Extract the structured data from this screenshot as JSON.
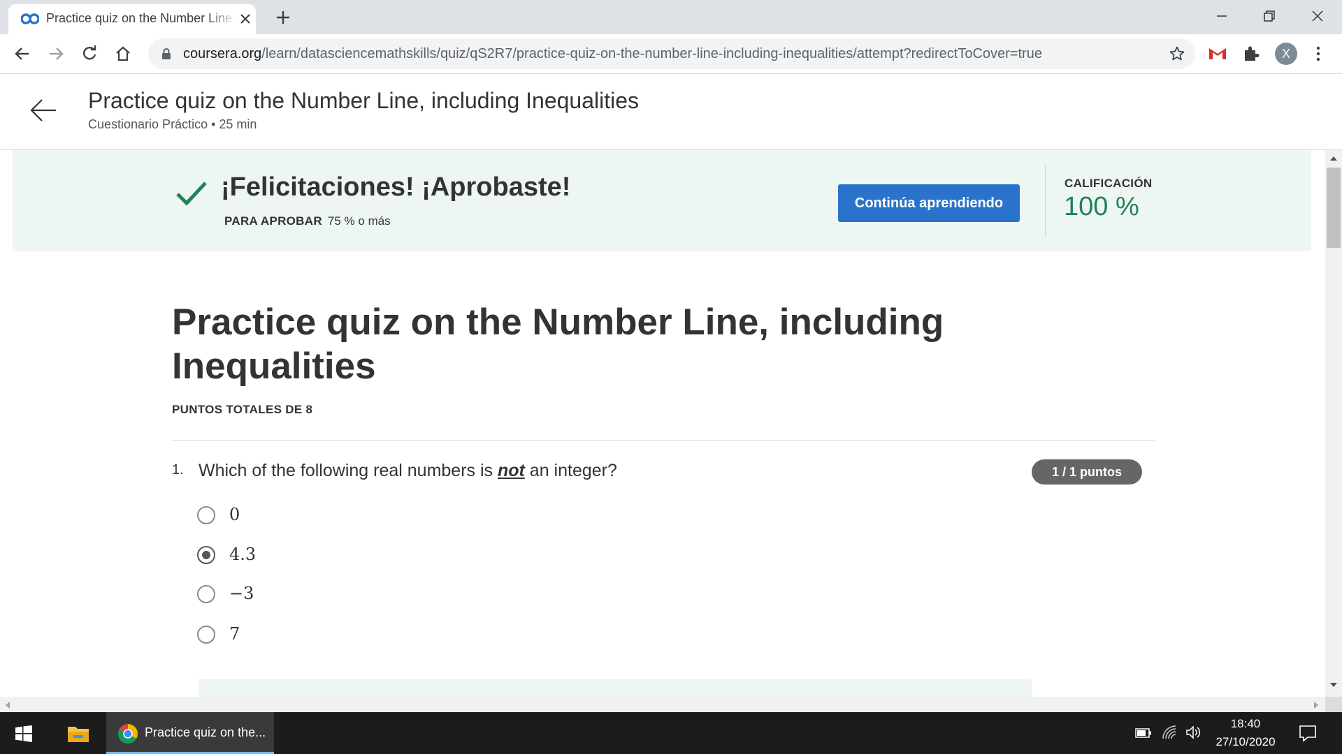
{
  "browser": {
    "tab_title": "Practice quiz on the Number Line, including Inequalities",
    "url_domain": "coursera.org",
    "url_path": "/learn/datasciencemathskills/quiz/qS2R7/practice-quiz-on-the-number-line-including-inequalities/attempt?redirectToCover=true",
    "profile_initial": "X"
  },
  "header": {
    "title": "Practice quiz on the Number Line, including Inequalities",
    "subtitle": "Cuestionario Práctico • 25 min"
  },
  "result_banner": {
    "message": "¡Felicitaciones! ¡Aprobaste!",
    "pass_label": "PARA APROBAR",
    "pass_value": "75 % o más",
    "continue_button": "Continúa aprendiendo",
    "grade_label": "CALIFICACIÓN",
    "grade_value": "100 %"
  },
  "quiz": {
    "title": "Practice quiz on the Number Line, including Inequalities",
    "total_points": "PUNTOS TOTALES DE 8",
    "questions": [
      {
        "number": "1.",
        "text_before": "Which of the following real numbers is ",
        "text_emphasis": "not",
        "text_after": " an integer?",
        "score": "1 / 1 puntos",
        "options": [
          {
            "label": "0",
            "selected": false
          },
          {
            "label": "4.3",
            "selected": true
          },
          {
            "label": "−3",
            "selected": false
          },
          {
            "label": "7",
            "selected": false
          }
        ]
      }
    ]
  },
  "taskbar": {
    "chrome_label": "Practice quiz on the...",
    "time": "18:40",
    "date": "27/10/2020"
  },
  "colors": {
    "accent_button": "#2a73cc",
    "success_green": "#1f8354",
    "banner_bg": "#eef6f4"
  }
}
